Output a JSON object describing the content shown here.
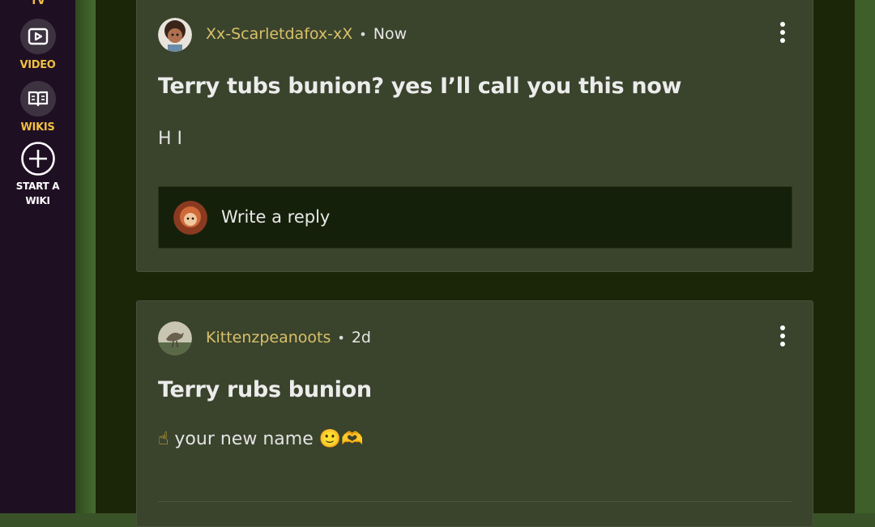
{
  "sidebar": {
    "items": [
      {
        "label": "TV",
        "icon": "tv-icon"
      },
      {
        "label": "VIDEO",
        "icon": "video-icon"
      },
      {
        "label": "WIKIS",
        "icon": "wikis-book-icon"
      },
      {
        "label_line1": "START A",
        "label_line2": "WIKI",
        "icon": "plus-circle-icon"
      }
    ]
  },
  "posts": [
    {
      "author": "Xx-Scarletdafox-xX",
      "separator": "•",
      "time": "Now",
      "title": "Terry tubs bunion? yes I’ll call you this now",
      "body": "H I",
      "reply_placeholder": "Write a reply"
    },
    {
      "author": "Kittenzpeanoots",
      "separator": "•",
      "time": "2d",
      "title": "Terry rubs bunion",
      "body_text": "your new name",
      "body_emoji_before": "☝",
      "body_emoji_after": "🙂🫶"
    }
  ],
  "colors": {
    "sidebar_bg": "#1f0f23",
    "sidebar_accent": "#f0c040",
    "card_bg": "#3a432c",
    "author": "#d8c06a",
    "page_bg": "#1b2508"
  }
}
